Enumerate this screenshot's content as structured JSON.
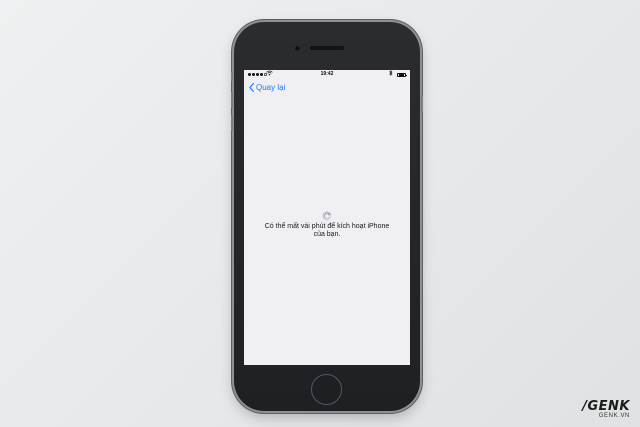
{
  "status_bar": {
    "time": "19:42",
    "signal_bars_filled": 4,
    "signal_bars_total": 5,
    "battery_level": 0.8,
    "wifi_icon": "wifi-icon",
    "bluetooth_icon": "bluetooth-icon"
  },
  "nav": {
    "back_label": "Quay lại",
    "back_icon": "chevron-left-icon"
  },
  "activation": {
    "message_line1": "Có thể mất vài phút để kích hoạt iPhone",
    "message_line2": "của bạn.",
    "spinner_icon": "activity-spinner-icon"
  },
  "watermark": {
    "logo": "/GENK",
    "url": "GENK.VN"
  },
  "colors": {
    "accent": "#1e7cf5",
    "screen_background": "#efeff4",
    "phone_body": "#2a2c2f"
  }
}
